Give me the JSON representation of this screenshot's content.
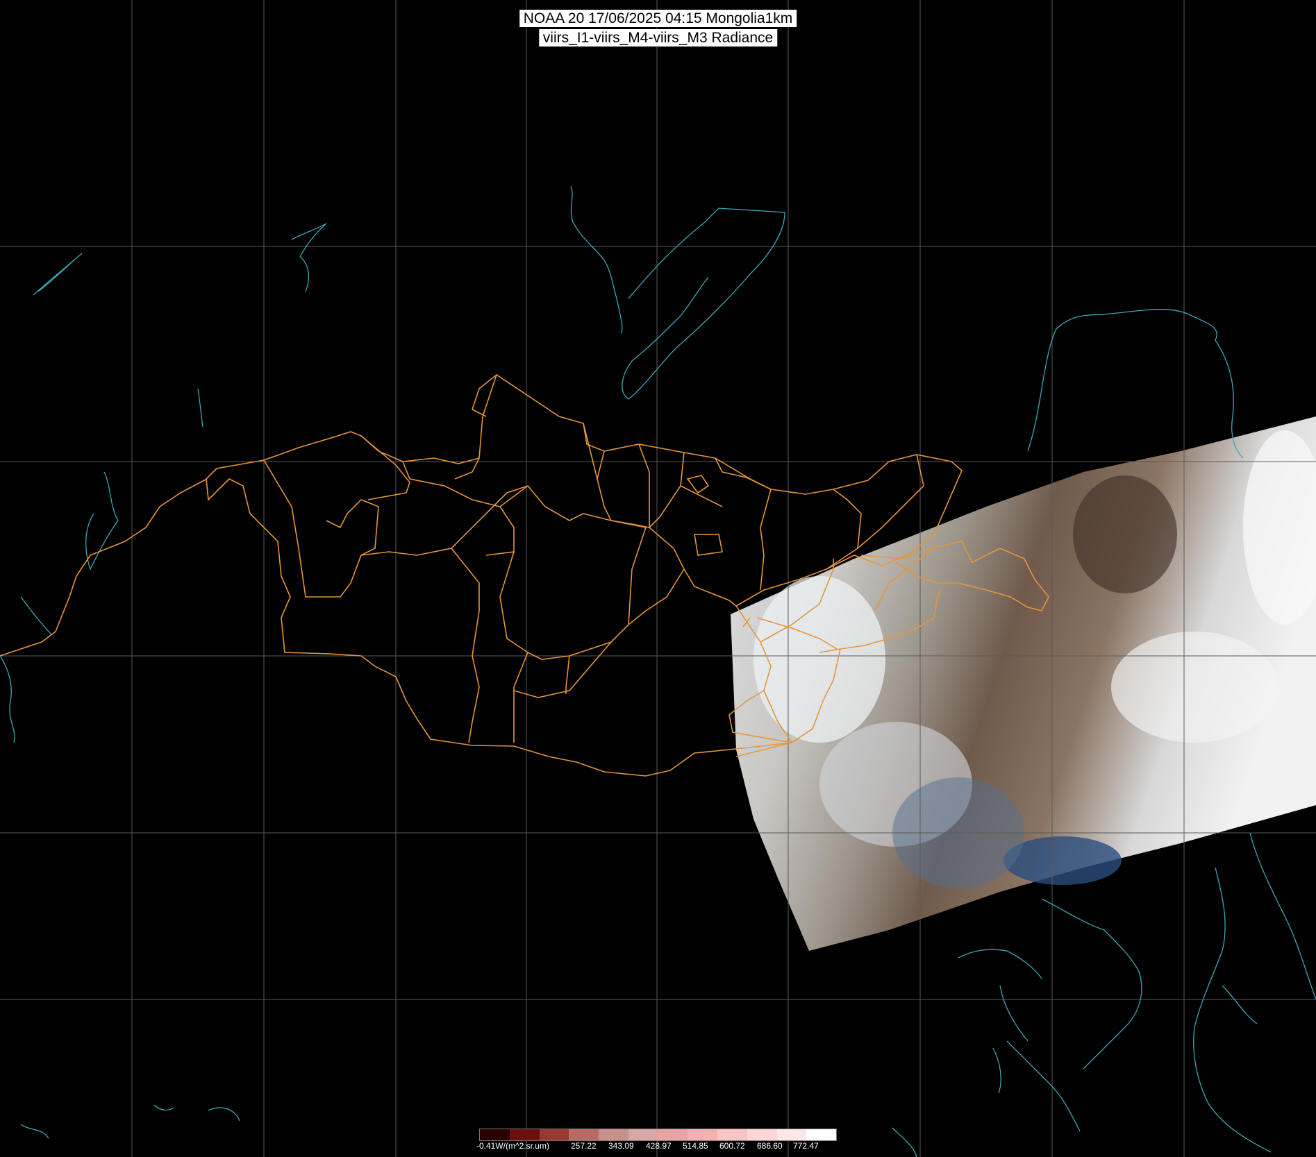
{
  "header": {
    "line1": "NOAA 20 17/06/2025 04:15 Mongolia1km",
    "line2": "viirs_I1-viirs_M4-viirs_M3 Radiance"
  },
  "colors": {
    "background": "#000000",
    "grid": "#5a5a5a",
    "coastline": "#3fa7b8",
    "boundary": "#e6953c"
  },
  "colorbar": {
    "swatches": [
      "#2a0000",
      "#6e0f0f",
      "#9a3a2f",
      "#b86b62",
      "#c98f8a",
      "#d9a8a6",
      "#e8a4a4",
      "#f3b1b1",
      "#f8c4c4",
      "#fbd7d7",
      "#fde8e8",
      "#ffffff"
    ],
    "labels": [
      "-0.41W/(m^2.sr.um)",
      "257.22",
      "343.09",
      "428.97",
      "514.85",
      "600.72",
      "686.60",
      "772.47"
    ]
  }
}
